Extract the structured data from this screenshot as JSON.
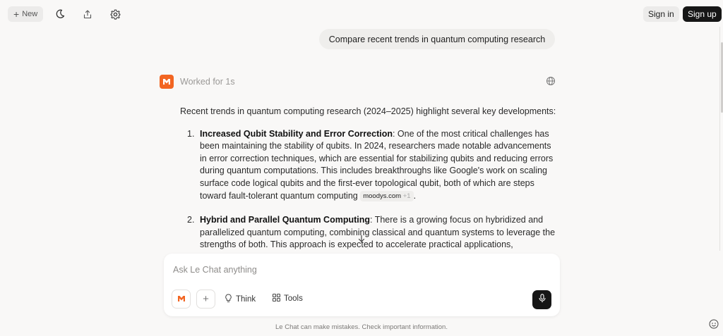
{
  "topbar": {
    "new_label": "New",
    "sign_in": "Sign in",
    "sign_up": "Sign up"
  },
  "chat": {
    "user_message": "Compare recent trends in quantum computing research",
    "worked_label": "Worked for 1s",
    "intro": "Recent trends in quantum computing research (2024–2025) highlight several key developments:",
    "items": [
      {
        "number": "1.",
        "title": "Increased Qubit Stability and Error Correction",
        "body": ": One of the most critical challenges has been maintaining the stability of qubits. In 2024, researchers made notable advancements in error correction techniques, which are essential for stabilizing qubits and reducing errors during quantum computations. This includes breakthroughs like Google's work on scaling surface code logical qubits and the first-ever topological qubit, both of which are steps toward fault-tolerant quantum computing",
        "source": "moodys.com",
        "source_more": "+1",
        "tail": "."
      },
      {
        "number": "2.",
        "title": "Hybrid and Parallel Quantum Computing",
        "body": ": There is a growing focus on hybridized and parallelized quantum computing, combining classical and quantum systems to leverage the strengths of both. This approach is expected to accelerate practical applications,"
      }
    ]
  },
  "composer": {
    "placeholder": "Ask Le Chat anything",
    "think_label": "Think",
    "tools_label": "Tools"
  },
  "footer": {
    "disclaimer": "Le Chat can make mistakes. Check important information."
  },
  "colors": {
    "brand_orange": "#f26522",
    "dark": "#161616",
    "background": "#f9f8f7"
  },
  "icons": [
    "plus-icon",
    "moon-icon",
    "share-icon",
    "gear-icon",
    "brand-logo-icon",
    "globe-icon",
    "arrow-down-icon",
    "lightbulb-icon",
    "tools-grid-icon",
    "mic-icon",
    "help-icon"
  ]
}
